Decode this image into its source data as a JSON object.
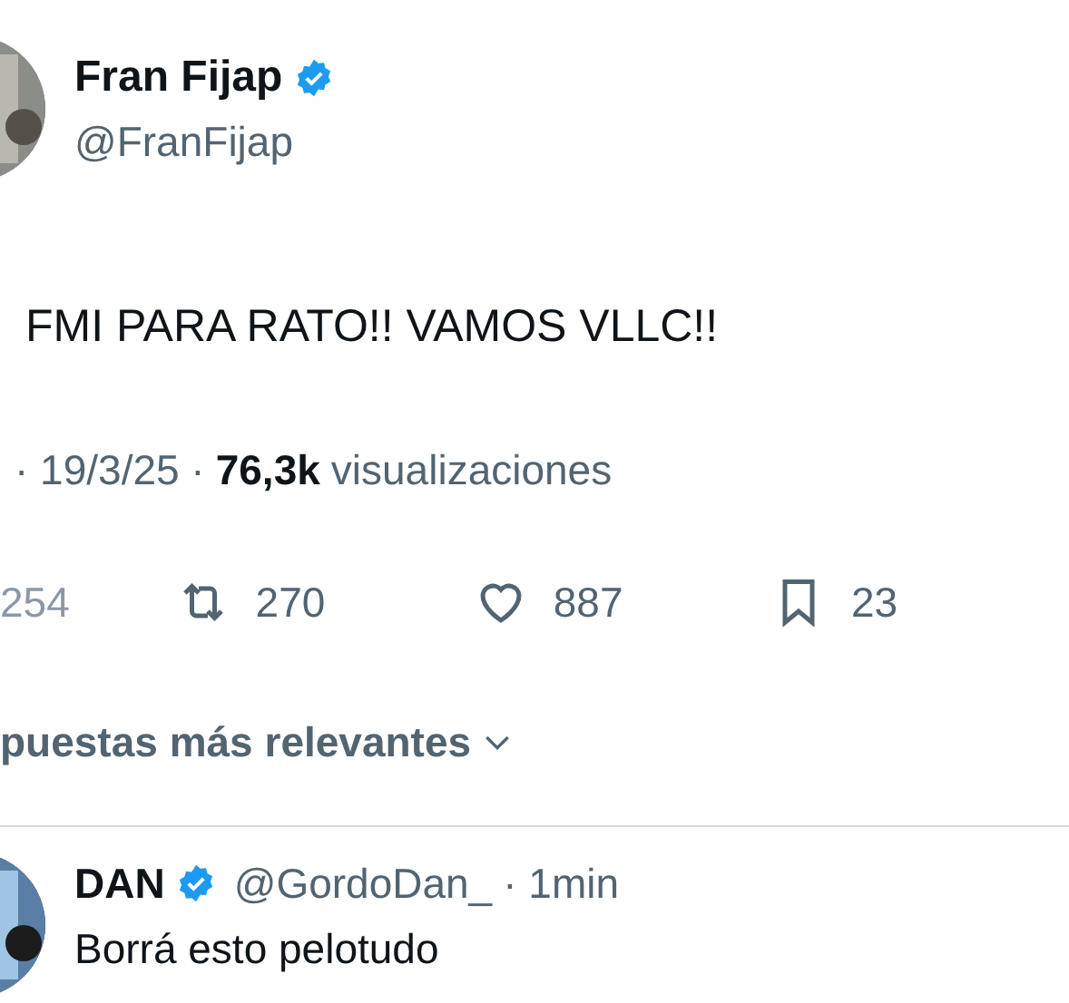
{
  "author": {
    "name": "Fran Fijap",
    "verified": true,
    "handle": "@FranFijap"
  },
  "tweet": {
    "text": "FMI PARA RATO!! VAMOS VLLC!!",
    "date": "· 19/3/25 ·",
    "views": "76,3k",
    "views_label": "visualizaciones"
  },
  "actions": [
    {
      "kind": "reply",
      "count": "254"
    },
    {
      "kind": "retweet",
      "count": "270"
    },
    {
      "kind": "like",
      "count": "887"
    },
    {
      "kind": "bookmark",
      "count": "23"
    }
  ],
  "replies_sort": {
    "label": "puestas más relevantes"
  },
  "replies": [
    {
      "name": "DAN",
      "verified": true,
      "handle": "@GordoDan_",
      "time": "· 1min",
      "text": "Borrá esto pelotudo"
    }
  ]
}
